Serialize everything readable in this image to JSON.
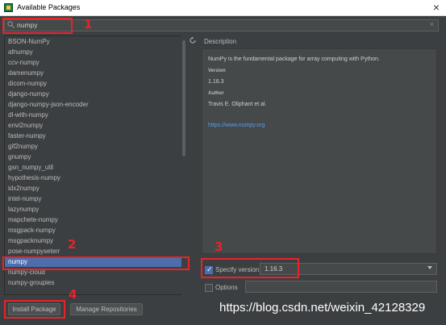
{
  "window": {
    "title": "Available Packages",
    "close_glyph": "×"
  },
  "search": {
    "icon": "search-icon",
    "query": "numpy",
    "clear_glyph": "×"
  },
  "packages": [
    "BSON-NumPy",
    "afnumpy",
    "ccv-numpy",
    "damenumpy",
    "dicom-numpy",
    "django-numpy",
    "django-numpy-json-encoder",
    "dl-with-numpy",
    "envi2numpy",
    "faster-numpy",
    "gif2numpy",
    "gnumpy",
    "gsn_numpy_util",
    "hypothesis-numpy",
    "idx2numpy",
    "intel-numpy",
    "lazynumpy",
    "mapchete-numpy",
    "msgpack-numpy",
    "msgpacknumpy",
    "pose-numpyseterr",
    "numpy",
    "numpy-cloud",
    "numpy-groupies"
  ],
  "selected_package": "numpy",
  "description": {
    "section_label": "Description",
    "summary": "NumPy is the fundamental package for array computing with Python.",
    "version_header": "Version",
    "version": "1.16.3",
    "author_header": "Author",
    "author": "Travis E. Oliphant et al.",
    "url": "https://www.numpy.org"
  },
  "specify_version": {
    "checked": true,
    "label": "Specify version",
    "value": "1.16.3"
  },
  "options": {
    "checked": false,
    "label": "Options",
    "value": ""
  },
  "buttons": {
    "install": "Install Package",
    "manage": "Manage Repositories"
  },
  "annotations": {
    "m1": "1",
    "m2": "2",
    "m3": "3",
    "m4": "4"
  },
  "watermark": "https://blog.csdn.net/weixin_42128329",
  "colors": {
    "background": "#3c3f41",
    "selection": "#4b6eaf",
    "annotation": "#e8232a",
    "link": "#589df6"
  }
}
